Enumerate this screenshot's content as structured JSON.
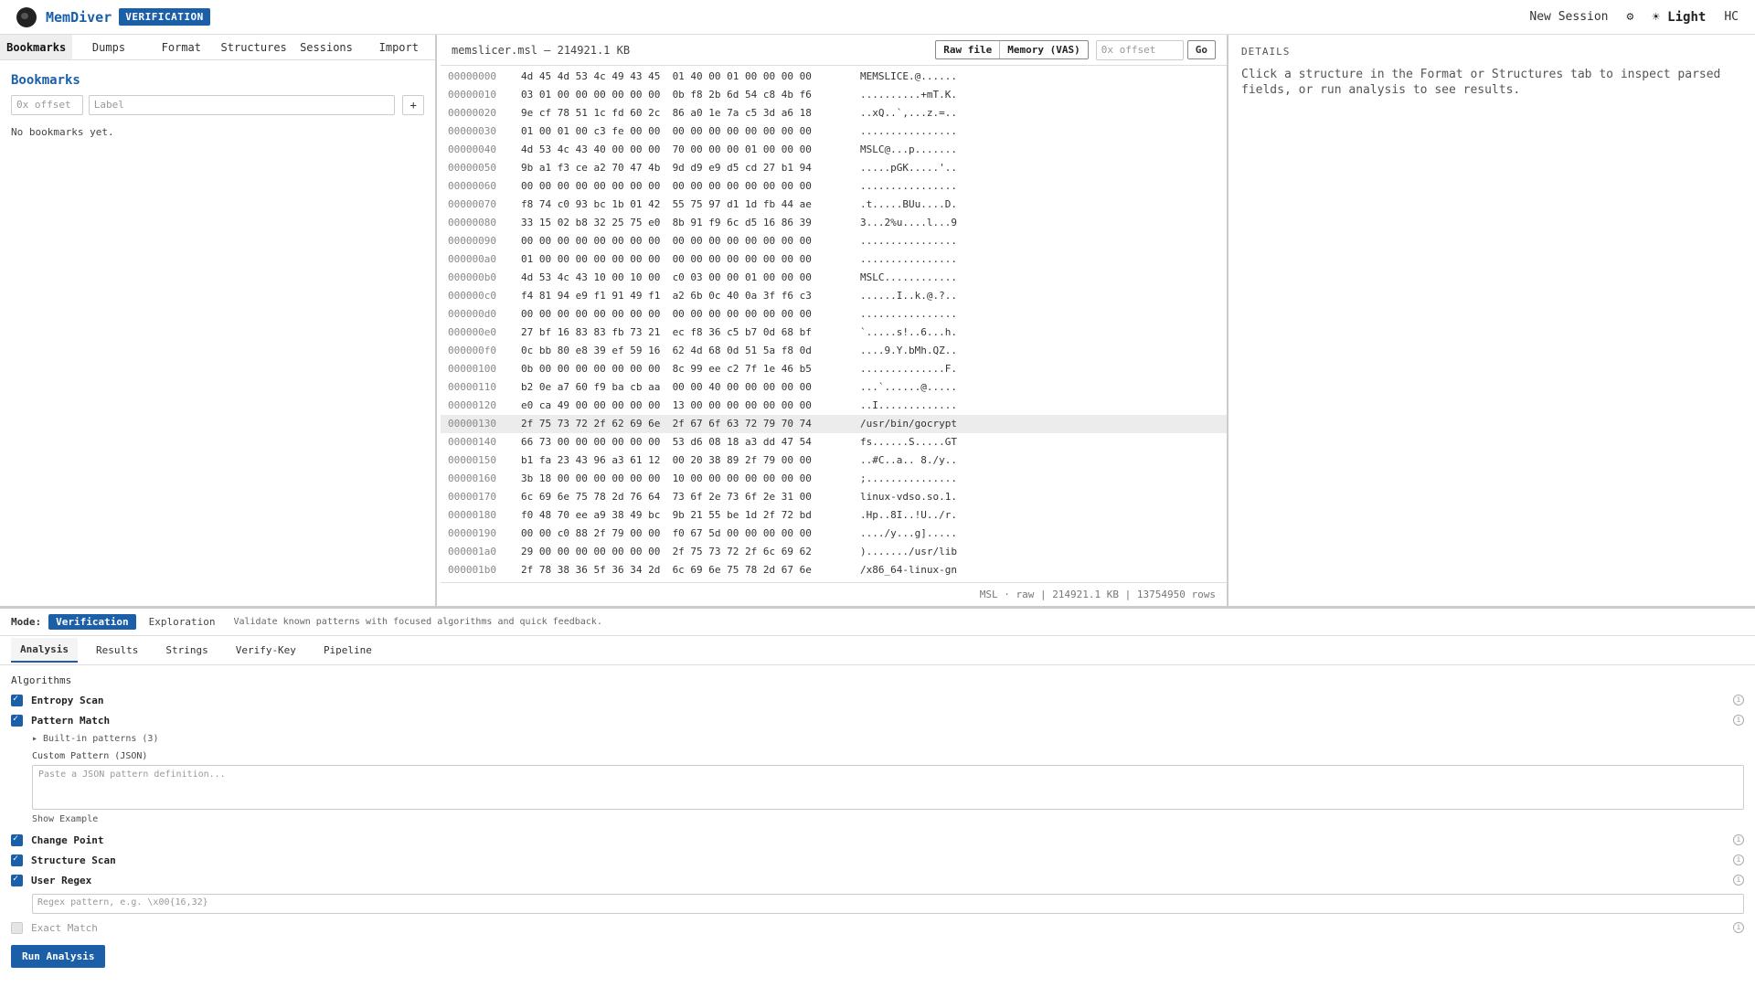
{
  "header": {
    "app_title": "MemDiver",
    "mode_badge": "VERIFICATION",
    "new_session": "New Session",
    "theme": "☀ Light",
    "hc": "HC"
  },
  "left": {
    "tabs": [
      "Bookmarks",
      "Dumps",
      "Format",
      "Structures",
      "Sessions",
      "Import"
    ],
    "title": "Bookmarks",
    "offset_placeholder": "0x offset",
    "label_placeholder": "Label",
    "add_label": "+",
    "empty_text": "No bookmarks yet."
  },
  "hex": {
    "file_name": "memslicer.msl — 214921.1 KB",
    "raw_btn": "Raw file",
    "mem_btn": "Memory (VAS)",
    "offset_placeholder": "0x offset",
    "go_btn": "Go",
    "rows": [
      {
        "off": "00000000",
        "bytes": "4d 45 4d 53 4c 49 43 45  01 40 00 01 00 00 00 00",
        "ascii": "MEMSLICE.@......"
      },
      {
        "off": "00000010",
        "bytes": "03 01 00 00 00 00 00 00  0b f8 2b 6d 54 c8 4b f6",
        "ascii": "..........+mT.K."
      },
      {
        "off": "00000020",
        "bytes": "9e cf 78 51 1c fd 60 2c  86 a0 1e 7a c5 3d a6 18",
        "ascii": "..xQ..`,...z.=.."
      },
      {
        "off": "00000030",
        "bytes": "01 00 01 00 c3 fe 00 00  00 00 00 00 00 00 00 00",
        "ascii": "................"
      },
      {
        "off": "00000040",
        "bytes": "4d 53 4c 43 40 00 00 00  70 00 00 00 01 00 00 00",
        "ascii": "MSLC@...p......."
      },
      {
        "off": "00000050",
        "bytes": "9b a1 f3 ce a2 70 47 4b  9d d9 e9 d5 cd 27 b1 94",
        "ascii": ".....pGK.....'.."
      },
      {
        "off": "00000060",
        "bytes": "00 00 00 00 00 00 00 00  00 00 00 00 00 00 00 00",
        "ascii": "................"
      },
      {
        "off": "00000070",
        "bytes": "f8 74 c0 93 bc 1b 01 42  55 75 97 d1 1d fb 44 ae",
        "ascii": ".t.....BUu....D."
      },
      {
        "off": "00000080",
        "bytes": "33 15 02 b8 32 25 75 e0  8b 91 f9 6c d5 16 86 39",
        "ascii": "3...2%u....l...9"
      },
      {
        "off": "00000090",
        "bytes": "00 00 00 00 00 00 00 00  00 00 00 00 00 00 00 00",
        "ascii": "................"
      },
      {
        "off": "000000a0",
        "bytes": "01 00 00 00 00 00 00 00  00 00 00 00 00 00 00 00",
        "ascii": "................"
      },
      {
        "off": "000000b0",
        "bytes": "4d 53 4c 43 10 00 10 00  c0 03 00 00 01 00 00 00",
        "ascii": "MSLC............"
      },
      {
        "off": "000000c0",
        "bytes": "f4 81 94 e9 f1 91 49 f1  a2 6b 0c 40 0a 3f f6 c3",
        "ascii": "......I..k.@.?.."
      },
      {
        "off": "000000d0",
        "bytes": "00 00 00 00 00 00 00 00  00 00 00 00 00 00 00 00",
        "ascii": "................"
      },
      {
        "off": "000000e0",
        "bytes": "27 bf 16 83 83 fb 73 21  ec f8 36 c5 b7 0d 68 bf",
        "ascii": "`.....s!..6...h."
      },
      {
        "off": "000000f0",
        "bytes": "0c bb 80 e8 39 ef 59 16  62 4d 68 0d 51 5a f8 0d",
        "ascii": "....9.Y.bMh.QZ.."
      },
      {
        "off": "00000100",
        "bytes": "0b 00 00 00 00 00 00 00  8c 99 ee c2 7f 1e 46 b5",
        "ascii": "..............F."
      },
      {
        "off": "00000110",
        "bytes": "b2 0e a7 60 f9 ba cb aa  00 00 40 00 00 00 00 00",
        "ascii": "...`......@....."
      },
      {
        "off": "00000120",
        "bytes": "e0 ca 49 00 00 00 00 00  13 00 00 00 00 00 00 00",
        "ascii": "..I............."
      },
      {
        "off": "00000130",
        "bytes": "2f 75 73 72 2f 62 69 6e  2f 67 6f 63 72 79 70 74",
        "ascii": "/usr/bin/gocrypt"
      },
      {
        "off": "00000140",
        "bytes": "66 73 00 00 00 00 00 00  53 d6 08 18 a3 dd 47 54",
        "ascii": "fs......S.....GT"
      },
      {
        "off": "00000150",
        "bytes": "b1 fa 23 43 96 a3 61 12  00 20 38 89 2f 79 00 00",
        "ascii": "..#C..a.. 8./y.."
      },
      {
        "off": "00000160",
        "bytes": "3b 18 00 00 00 00 00 00  10 00 00 00 00 00 00 00",
        "ascii": ";..............."
      },
      {
        "off": "00000170",
        "bytes": "6c 69 6e 75 78 2d 76 64  73 6f 2e 73 6f 2e 31 00",
        "ascii": "linux-vdso.so.1."
      },
      {
        "off": "00000180",
        "bytes": "f0 48 70 ee a9 38 49 bc  9b 21 55 be 1d 2f 72 bd",
        "ascii": ".Hp..8I..!U../r."
      },
      {
        "off": "00000190",
        "bytes": "00 00 c0 88 2f 79 00 00  f0 67 5d 00 00 00 00 00",
        "ascii": "..../y...g]....."
      },
      {
        "off": "000001a0",
        "bytes": "29 00 00 00 00 00 00 00  2f 75 73 72 2f 6c 69 62",
        "ascii": ")......./usr/lib"
      },
      {
        "off": "000001b0",
        "bytes": "2f 78 38 36 5f 36 34 2d  6c 69 6e 75 78 2d 67 6e",
        "ascii": "/x86_64-linux-gn"
      }
    ],
    "highlighted_row": "00000130",
    "status": "MSL · raw | 214921.1 KB | 13754950 rows"
  },
  "details": {
    "label": "DETAILS",
    "text": "Click a structure in the Format or Structures tab to inspect parsed fields, or run analysis to see results."
  },
  "bottom": {
    "mode_label": "Mode:",
    "mode_active": "Verification",
    "mode_other": "Exploration",
    "mode_desc": "Validate known patterns with focused algorithms and quick feedback.",
    "tabs": [
      "Analysis",
      "Results",
      "Strings",
      "Verify-Key",
      "Pipeline"
    ],
    "algorithms_title": "Algorithms",
    "entropy": "Entropy Scan",
    "pattern": "Pattern Match",
    "builtin": "▸ Built-in patterns (3)",
    "custom_label": "Custom Pattern (JSON)",
    "custom_placeholder": "Paste a JSON pattern definition...",
    "show_example": "Show Example",
    "change_point": "Change Point",
    "structure_scan": "Structure Scan",
    "user_regex": "User Regex",
    "regex_placeholder": "Regex pattern, e.g. \\x00{16,32}",
    "exact_match": "Exact Match",
    "run_btn": "Run Analysis",
    "info": "i"
  },
  "colors": {
    "accent": "#1a5fa8"
  }
}
